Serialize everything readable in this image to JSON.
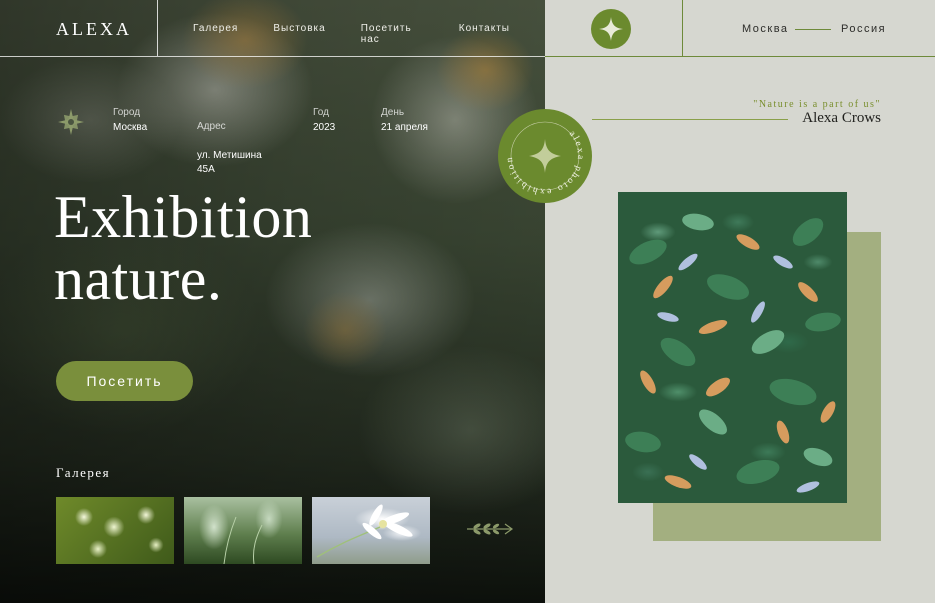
{
  "brand": {
    "logo": "ALEXA"
  },
  "nav": {
    "items": [
      "Галерея",
      "Выстовка",
      "Посетить нас",
      "Контакты"
    ]
  },
  "location": {
    "city": "Москва",
    "country": "Россия"
  },
  "info": [
    {
      "label": "Город",
      "value": "Москва"
    },
    {
      "label": "Адрес",
      "value": "ул. Метишина\n45А"
    },
    {
      "label": "Год",
      "value": "2023"
    },
    {
      "label": "День",
      "value": "21 апреля"
    }
  ],
  "hero": {
    "line1": "Exhibition",
    "line2": "nature.",
    "button": "Посетить"
  },
  "gallery": {
    "title": "Галерея"
  },
  "badge": {
    "text": "alexa photo exhibition"
  },
  "quote": {
    "text": "\"Nature is a part of us\"",
    "author": "Alexa Crows"
  },
  "colors": {
    "accent": "#6b8a2e",
    "panel": "#d6d7d0",
    "sage": "#a3af80"
  }
}
